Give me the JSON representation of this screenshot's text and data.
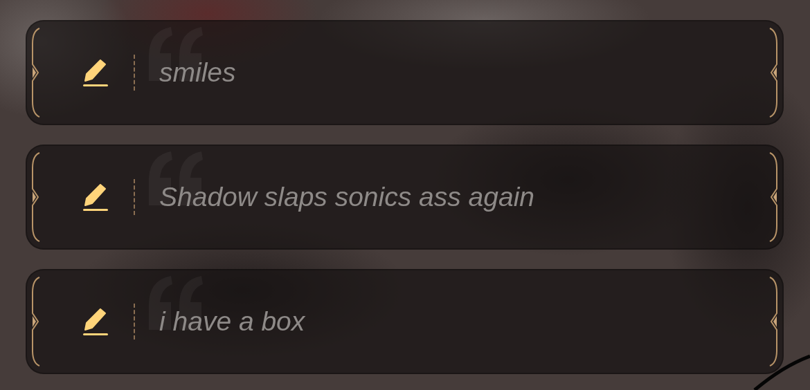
{
  "options": [
    {
      "text": "smiles"
    },
    {
      "text": "Shadow slaps sonics ass again"
    },
    {
      "text": "i have a box"
    }
  ]
}
